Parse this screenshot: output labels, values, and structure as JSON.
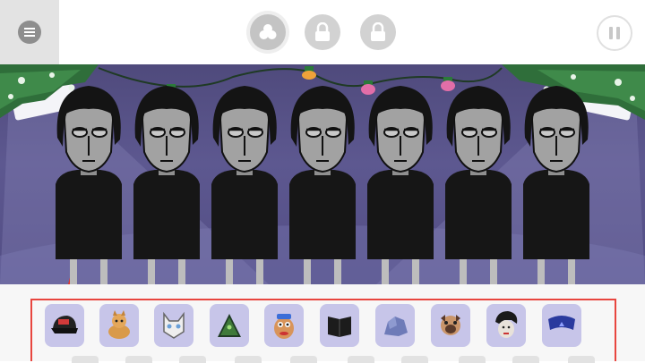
{
  "top_bar": {
    "menu_icon": "hamburger-icon",
    "buttons": [
      {
        "name": "mode-button",
        "icon": "clover-icon",
        "state": "active"
      },
      {
        "name": "bonus-button-1",
        "icon": "lock-icon",
        "state": "locked"
      },
      {
        "name": "bonus-button-2",
        "icon": "lock-icon",
        "state": "locked"
      }
    ],
    "pause_icon": "pause-icon"
  },
  "stage": {
    "character_count": 7,
    "decoration": "christmas-garland"
  },
  "sound_bar": {
    "items": [
      {
        "name": "sound-icon-cap",
        "icon": "cap-icon"
      },
      {
        "name": "sound-icon-dog",
        "icon": "dog-icon"
      },
      {
        "name": "sound-icon-cat",
        "icon": "cat-icon"
      },
      {
        "name": "sound-icon-pyramid",
        "icon": "pyramid-icon"
      },
      {
        "name": "sound-icon-potato",
        "icon": "potato-head-icon"
      },
      {
        "name": "sound-icon-book",
        "icon": "book-icon"
      },
      {
        "name": "sound-icon-rock",
        "icon": "rock-icon"
      },
      {
        "name": "sound-icon-pug",
        "icon": "pug-icon"
      },
      {
        "name": "sound-icon-hair",
        "icon": "hair-icon"
      },
      {
        "name": "sound-icon-headband",
        "icon": "headband-icon"
      }
    ]
  },
  "colors": {
    "stage_background": "#4f4a7c",
    "highlight_border": "#e8463f",
    "icon_tile": "#c7c5e9"
  }
}
